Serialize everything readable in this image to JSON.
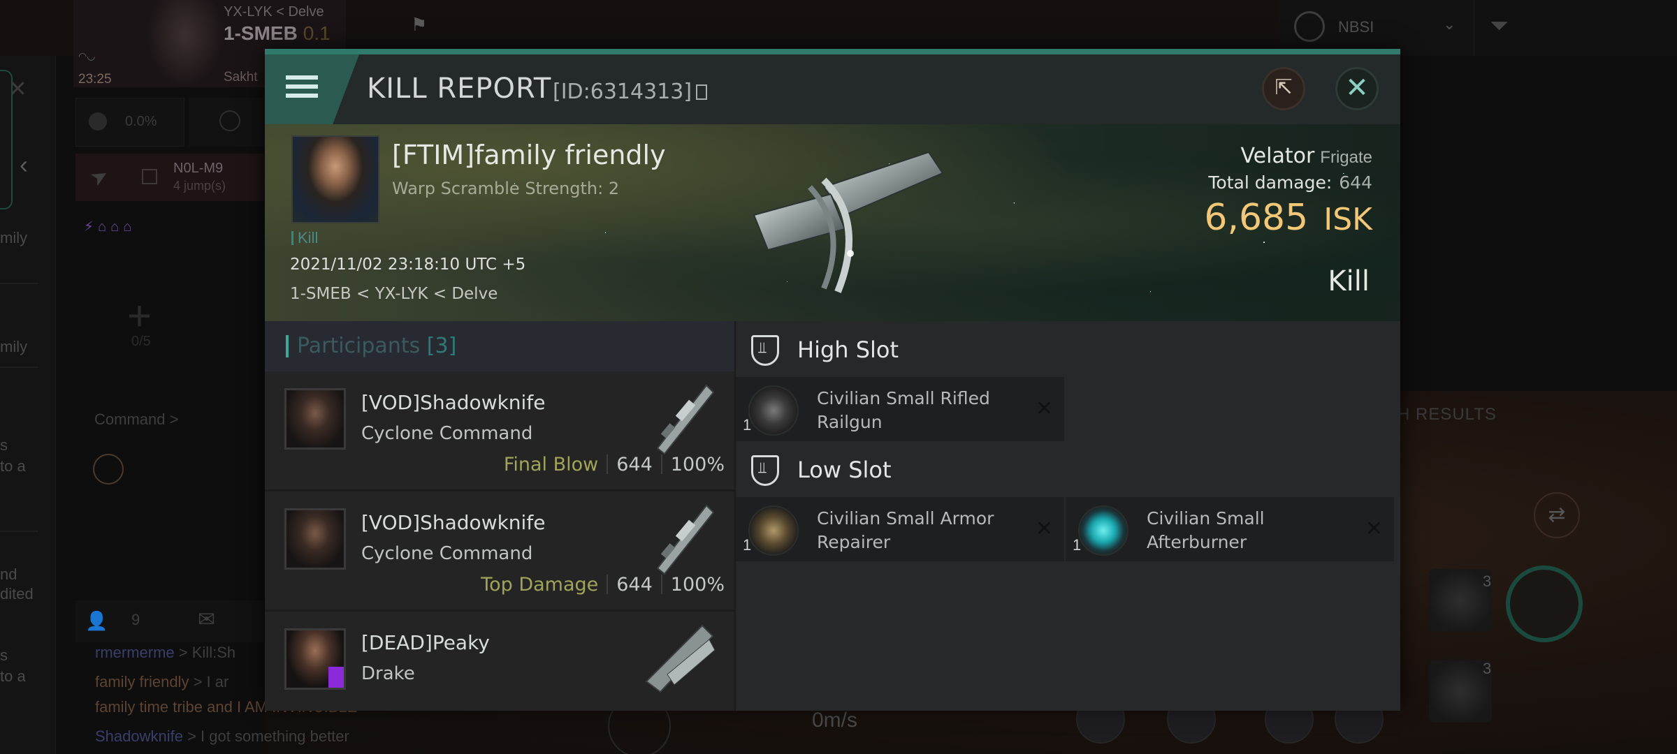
{
  "background": {
    "character": {
      "time": "23:25",
      "region_line": "YX-LYK < Delve",
      "system": "1-SMEB",
      "security": "0.1",
      "name_partial": "Sakht"
    },
    "stats": {
      "value": "0.0%"
    },
    "destination": {
      "name": "N0L-M9",
      "jumps": "4 jump(s)"
    },
    "fleet": {
      "count": "0/5",
      "command_label": "Command >"
    },
    "overview": {
      "filter_label": "NBSI",
      "search_label": "H RESULTS"
    },
    "left_strip_texts": [
      "mily",
      "mily",
      "s",
      "to a",
      "nd",
      "dited",
      "s",
      "to a"
    ],
    "chat": {
      "member_count": "9",
      "lines": [
        {
          "name": "rmermerme",
          "msg": " > Kill:Sh",
          "color": "blue"
        },
        {
          "name": "family friendly",
          "msg": " > I ar",
          "color": "orange"
        },
        {
          "name": "",
          "msg": "family time tribe and I AM INVINCIBLE",
          "color": "orange"
        },
        {
          "name": "Shadowknife",
          "msg": " > I got something better",
          "color": "blue"
        }
      ]
    },
    "speed": "0m/s",
    "module_counts": [
      "3",
      "3"
    ]
  },
  "modal": {
    "title": "KILL REPORT",
    "id": "[ID:6314313]",
    "victim": {
      "name": "[FTIM]family friendly",
      "subtitle": "Warp Scramble Strength: 2",
      "kills": "Kill",
      "datetime": "2021/11/02 23:18:10 UTC +5",
      "location": "1-SMEB < YX-LYK < Delve",
      "ship_name": "Velator",
      "ship_class": "Frigate",
      "total_damage_label": "Total damage:",
      "total_damage": "644",
      "isk_value": "6,685",
      "isk_unit": "ISK",
      "result": "Kill"
    },
    "participants": {
      "title": "Participants",
      "count": "[3]",
      "rows": [
        {
          "name": "[VOD]Shadowknife",
          "ship": "Cyclone Command",
          "tag": "Final Blow",
          "damage": "644",
          "percent": "100%"
        },
        {
          "name": "[VOD]Shadowknife",
          "ship": "Cyclone Command",
          "tag": "Top Damage",
          "damage": "644",
          "percent": "100%"
        },
        {
          "name": "[DEAD]Peaky",
          "ship": "Drake",
          "tag": "",
          "damage": "",
          "percent": ""
        }
      ]
    },
    "fitting": {
      "high_slot": {
        "title": "High Slot",
        "items": [
          {
            "name": "Civilian Small Rifled Railgun",
            "qty": "1",
            "icon": "railgun"
          }
        ]
      },
      "low_slot": {
        "title": "Low Slot",
        "items": [
          {
            "name": "Civilian Small Armor Repairer",
            "qty": "1",
            "icon": "armor"
          },
          {
            "name": "Civilian Small Afterburner",
            "qty": "1",
            "icon": "ab"
          }
        ]
      }
    }
  },
  "colors": {
    "accent": "#2f7a6a",
    "isk": "#f3c778",
    "tag": "#a2a45a",
    "participants_count": "#2f7a78"
  }
}
